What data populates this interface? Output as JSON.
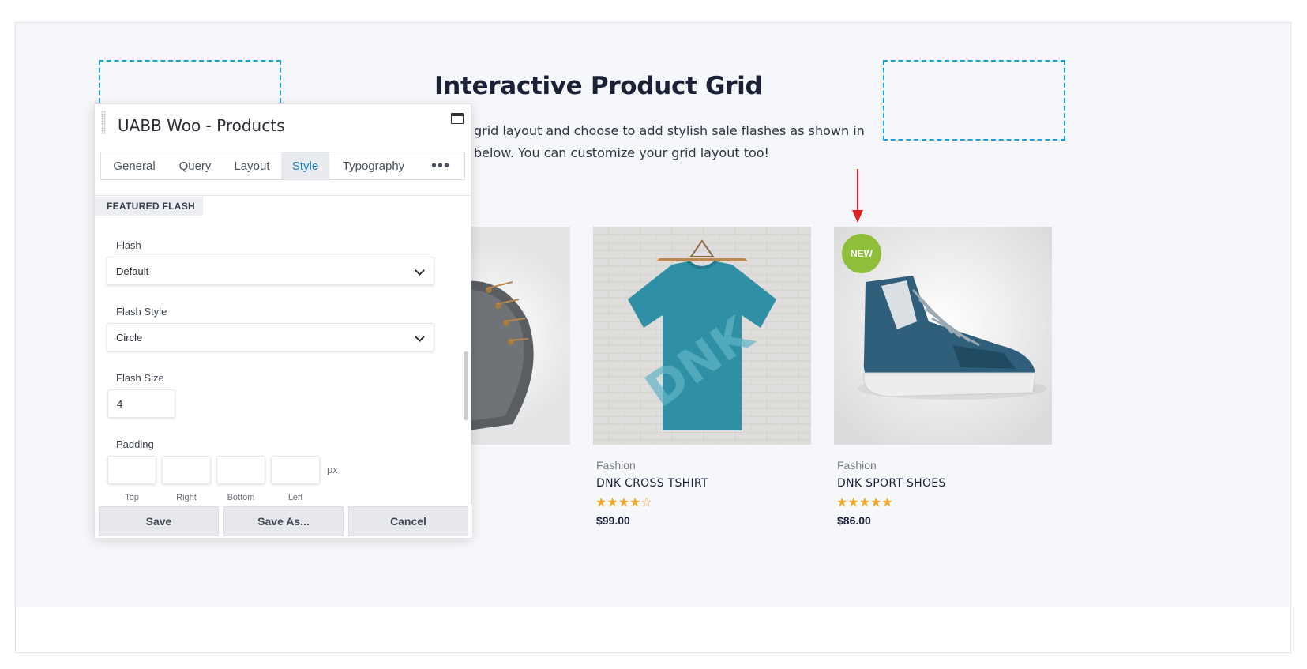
{
  "page": {
    "heading": "Interactive Product Grid",
    "subtext_line1": "grid layout and choose to add stylish sale flashes as shown in",
    "subtext_line2": "below. You can customize your grid layout too!"
  },
  "products": [
    {
      "category": "",
      "name": "",
      "rating": "",
      "price": ""
    },
    {
      "category": "Fashion",
      "name": "DNK CROSS TSHIRT",
      "rating": "★★★★☆",
      "price": "$99.00"
    },
    {
      "category": "Fashion",
      "name": "DNK SPORT SHOES",
      "rating": "★★★★★",
      "price": "$86.00",
      "badge": "NEW"
    }
  ],
  "colors": {
    "accent": "#1383c4",
    "badge": "#8fbe3b",
    "star": "#f5a623",
    "arrow": "#e02020",
    "placeholder": "#1e9fd1"
  },
  "panel": {
    "title": "UABB Woo - Products",
    "tabs": [
      {
        "label": "General"
      },
      {
        "label": "Query"
      },
      {
        "label": "Layout"
      },
      {
        "label": "Style",
        "active": true
      },
      {
        "label": "Typography"
      }
    ],
    "more_label": "•••",
    "section_label": "FEATURED FLASH",
    "fields": {
      "flash_label": "Flash",
      "flash_value": "Default",
      "flash_style_label": "Flash Style",
      "flash_style_value": "Circle",
      "flash_size_label": "Flash Size",
      "flash_size_value": "4",
      "padding_label": "Padding",
      "padding_unit": "px",
      "padding_top": "Top",
      "padding_right": "Right",
      "padding_bottom": "Bottom",
      "padding_left": "Left"
    },
    "buttons": {
      "save": "Save",
      "save_as": "Save As...",
      "cancel": "Cancel"
    }
  }
}
